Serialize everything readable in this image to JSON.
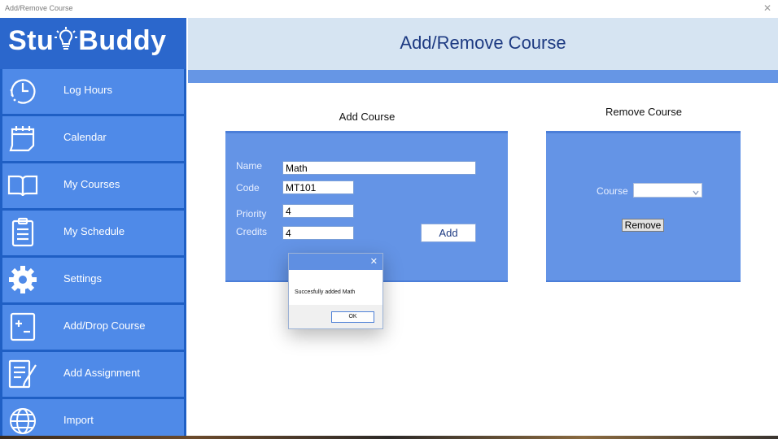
{
  "window": {
    "title": "Add/Remove Course",
    "close_glyph": "✕"
  },
  "sidebar": {
    "logo_prefix": "Stu",
    "logo_suffix": "Buddy",
    "items": [
      {
        "label": "Log Hours",
        "icon": "clock-icon"
      },
      {
        "label": "Calendar",
        "icon": "calendar-icon"
      },
      {
        "label": "My Courses",
        "icon": "book-icon"
      },
      {
        "label": "My Schedule",
        "icon": "clipboard-icon"
      },
      {
        "label": "Settings",
        "icon": "gear-icon"
      },
      {
        "label": "Add/Drop Course",
        "icon": "plus-minus-icon"
      },
      {
        "label": "Add Assignment",
        "icon": "notepad-pen-icon"
      },
      {
        "label": "Import",
        "icon": "globe-icon"
      }
    ]
  },
  "header": {
    "title": "Add/Remove Course"
  },
  "add_course": {
    "title": "Add Course",
    "fields": {
      "name": {
        "label": "Name",
        "value": "Math"
      },
      "code": {
        "label": "Code",
        "value": "MT101"
      },
      "priority": {
        "label": "Priority",
        "value": "4"
      },
      "credits": {
        "label": "Credits",
        "value": "4"
      }
    },
    "add_label": "Add"
  },
  "remove_course": {
    "title": "Remove Course",
    "course_label": "Course",
    "course_value": "",
    "remove_label": "Remove"
  },
  "dialog": {
    "message": "Succesfully added Math",
    "ok_label": "OK",
    "close_glyph": "✕"
  },
  "colors": {
    "sidebar_bg": "#1f5fc4",
    "nav_item": "#4f8ae8",
    "header_bg": "#d6e4f2",
    "panel": "#6494e6",
    "accent_text": "#1d3a82"
  }
}
